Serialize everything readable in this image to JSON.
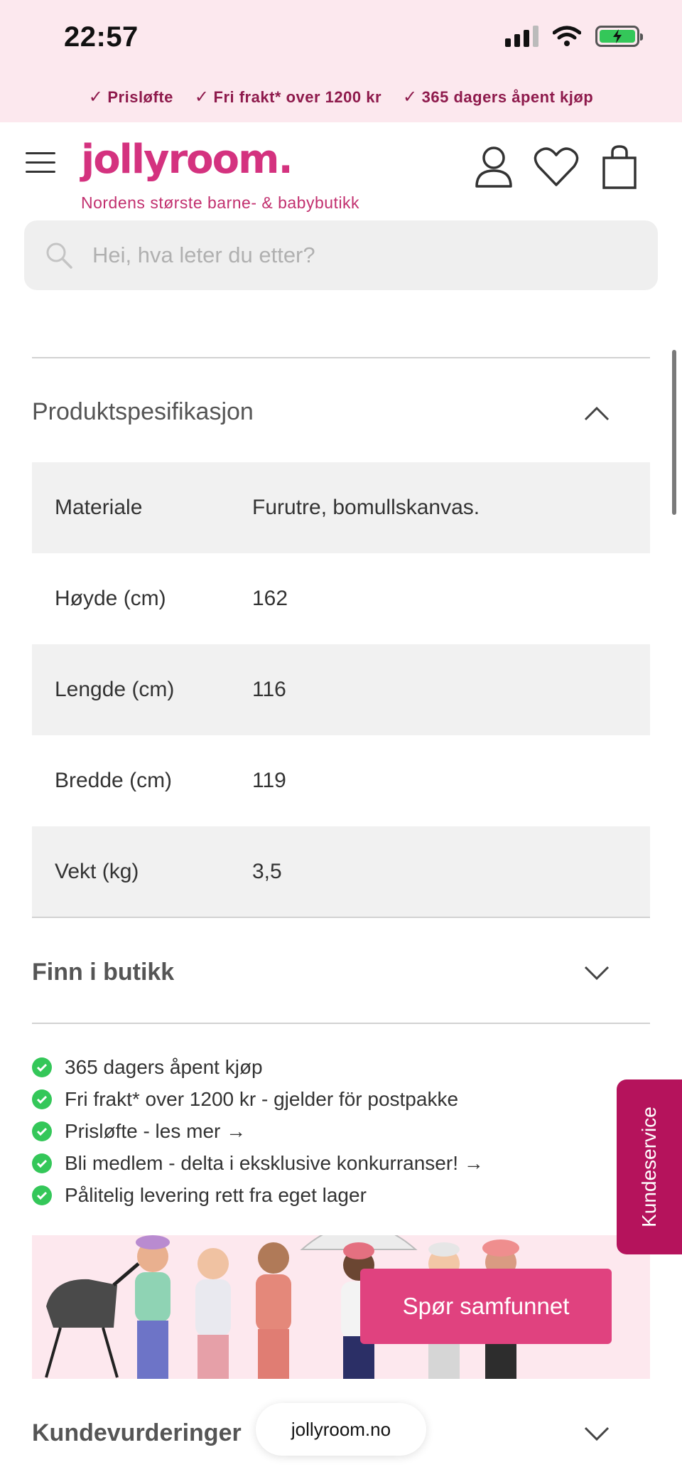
{
  "status_bar": {
    "time": "22:57"
  },
  "promo": {
    "items": [
      "Prisløfte",
      "Fri frakt* over 1200 kr",
      "365 dagers åpent kjøp"
    ]
  },
  "header": {
    "logo": "jollyroom.",
    "tagline": "Nordens største barne- & babybutikk"
  },
  "search": {
    "placeholder": "Hei, hva leter du etter?"
  },
  "spec": {
    "title": "Produktspesifikasjon",
    "rows": [
      {
        "label": "Materiale",
        "value": "Furutre, bomullskanvas."
      },
      {
        "label": "Høyde (cm)",
        "value": "162"
      },
      {
        "label": "Lengde (cm)",
        "value": "116"
      },
      {
        "label": "Bredde (cm)",
        "value": "119"
      },
      {
        "label": "Vekt (kg)",
        "value": "3,5"
      }
    ]
  },
  "find_in_store": {
    "title": "Finn i butikk"
  },
  "usps": [
    "365 dagers åpent kjøp",
    "Fri frakt* over 1200 kr - gjelder för postpakke",
    "Prisløfte - les mer →",
    "Bli medlem - delta i eksklusive konkurranser! →",
    "Pålitelig levering rett fra eget lager"
  ],
  "community": {
    "button_label": "Spør samfunnet"
  },
  "customer_service": {
    "label": "Kundeservice"
  },
  "reviews": {
    "title": "Kundevurderinger"
  },
  "browser": {
    "url": "jollyroom.no"
  },
  "colors": {
    "brand_pink": "#d4327f",
    "promo_text": "#8e1a4c",
    "button_pink": "#e0427f",
    "kundeservice_bg": "#b5135c",
    "check_green": "#34c759"
  }
}
